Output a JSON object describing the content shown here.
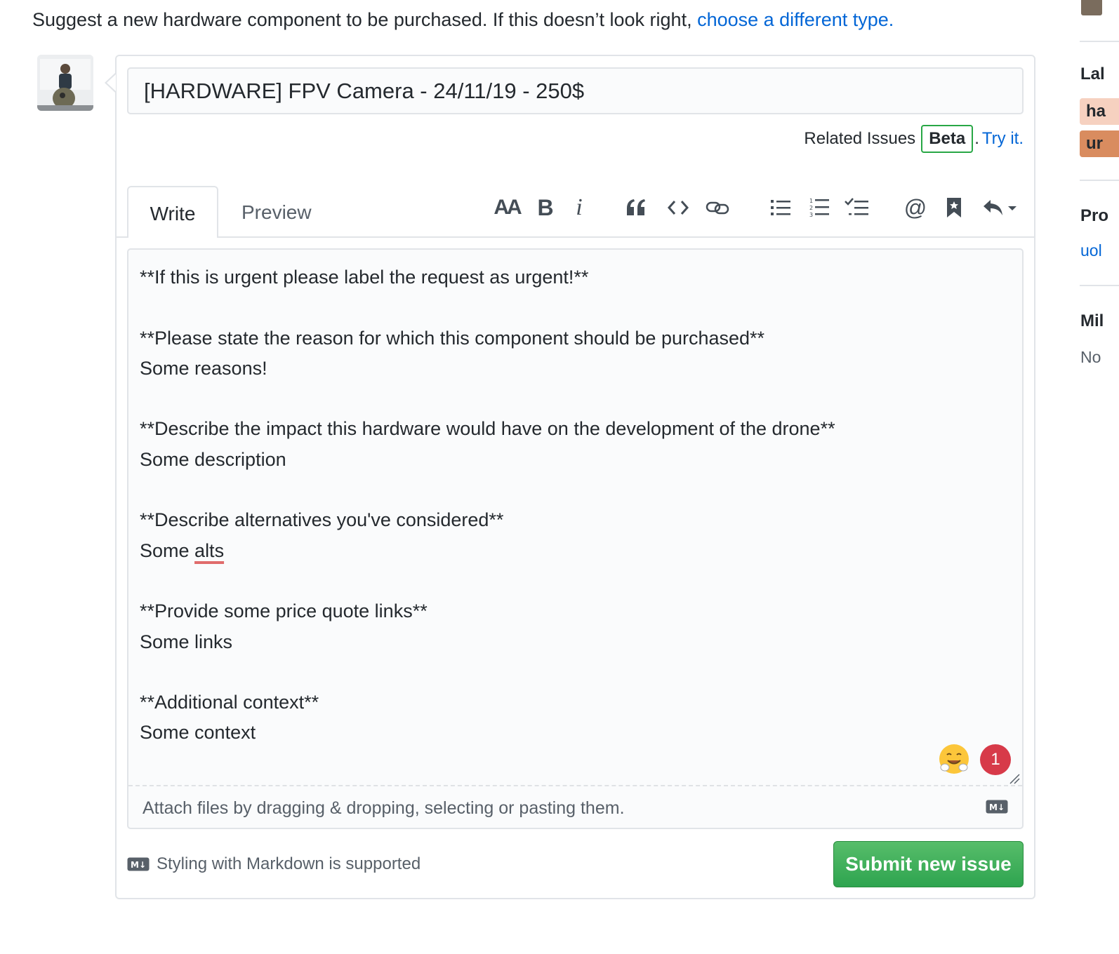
{
  "intro": {
    "text": "Suggest a new hardware component to be purchased. If this doesn’t look right, ",
    "link": "choose a different type."
  },
  "issue": {
    "title_value": "[HARDWARE] FPV Camera - 24/11/19 - 250$",
    "related_label": "Related Issues",
    "beta_badge": "Beta",
    "related_dot": ".",
    "try_link": "Try it."
  },
  "tabs": {
    "write": "Write",
    "preview": "Preview"
  },
  "toolbar": {
    "icons": [
      "text-size-icon",
      "bold-icon",
      "italic-icon",
      "quote-icon",
      "code-icon",
      "link-icon",
      "unordered-list-icon",
      "ordered-list-icon",
      "task-list-icon",
      "mention-icon",
      "reference-icon",
      "reply-icon"
    ],
    "text_size": "AA",
    "bold": "B",
    "italic": "i",
    "mention": "@"
  },
  "editor": {
    "line1": "**If this is urgent please label the request as urgent!**",
    "line2": "**Please state the reason for which this component should be purchased**",
    "line3": "Some reasons!",
    "line4": "**Describe the impact this hardware would have on the development of the drone**",
    "line5": "Some description",
    "line6": "**Describe alternatives you've considered**",
    "line7a": "Some ",
    "line7b": "alts",
    "line8": "**Provide some price quote links**",
    "line9": "Some links",
    "line10": "**Additional context**",
    "line11": "Some context",
    "badge_count": "1"
  },
  "attach": {
    "text": "Attach files by dragging & dropping, selecting or pasting them.",
    "md_icon_label": "M↓"
  },
  "footer": {
    "markdown_note": "Styling with Markdown is supported",
    "submit": "Submit new issue"
  },
  "sidebar": {
    "labels_heading": "Lal",
    "label_1": "ha",
    "label_2": "ur",
    "projects_heading": "Pro",
    "project_link": "uol",
    "milestone_heading": "Mil",
    "milestone_value": "No"
  },
  "colors": {
    "link": "#0366d6",
    "submit_green": "#2ea44f",
    "beta_border": "#28a745",
    "badge_red": "#d73a49",
    "label_1_bg": "#f6d1c0",
    "label_2_bg": "#d98c5f"
  }
}
